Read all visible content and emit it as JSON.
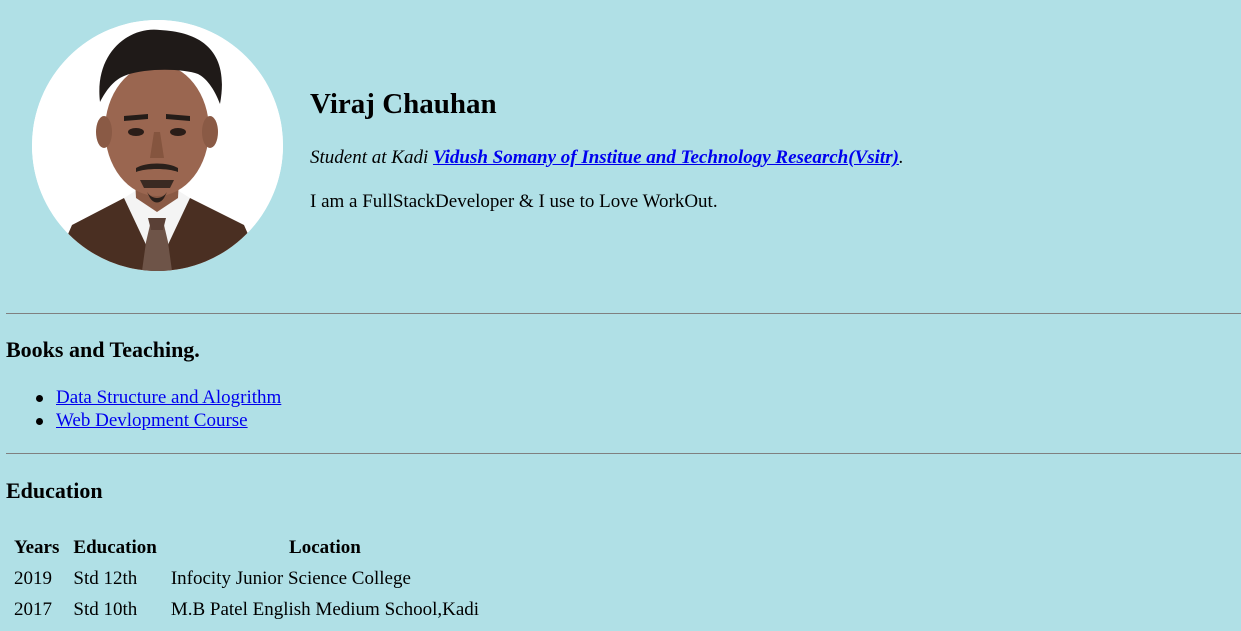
{
  "profile": {
    "name": "Viraj Chauhan",
    "subtitle_prefix": "Student at Kadi ",
    "college_link": "Vidush Somany of Institue and Technology Research(Vsitr)",
    "subtitle_suffix": ".",
    "bio": "I am a FullStackDeveloper & I use to Love WorkOut."
  },
  "books": {
    "heading": "Books and Teaching.",
    "items": [
      {
        "label": "Data Structure and Alogrithm"
      },
      {
        "label": "Web Devlopment Course"
      }
    ]
  },
  "education": {
    "heading": "Education",
    "columns": [
      "Years",
      "Education",
      "Location"
    ],
    "rows": [
      {
        "year": "2019",
        "education": "Std 12th",
        "location": "Infocity Junior Science College"
      },
      {
        "year": "2017",
        "education": "Std 10th",
        "location": "M.B Patel English Medium School,Kadi"
      }
    ]
  },
  "colors": {
    "background": "#b0e0e6",
    "link": "#0000ee",
    "divider": "#808080"
  }
}
